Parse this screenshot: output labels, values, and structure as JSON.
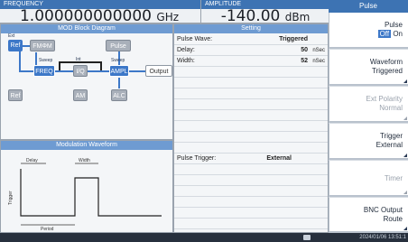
{
  "header": {
    "frequency_label": "FREQUENCY",
    "frequency_value": "1.000000000000",
    "frequency_unit": "GHz",
    "amplitude_label": "AMPLITUDE",
    "amplitude_value": "-140.00",
    "amplitude_unit": "dBm"
  },
  "diagram": {
    "title": "MOD Block Diagram",
    "blocks": {
      "ref1": "Ref",
      "fmphim": "FMΦM",
      "pulse": "Pulse",
      "freq": "FREQ",
      "iq": "I/Q",
      "ampl": "AMPL",
      "output": "Output",
      "ref2": "Ref",
      "am": "AM",
      "alc": "ALC"
    },
    "small_labels": {
      "sweep1": "Sweep",
      "sweep2": "Sweep",
      "int": "Int",
      "ext": "Ext"
    }
  },
  "waveform": {
    "title": "Modulation Waveform",
    "width_label": "Width",
    "delay_label": "Delay",
    "period_label": "Period",
    "trigger_label": "Trigger"
  },
  "setting": {
    "title": "Setting",
    "rows": [
      {
        "key": "Pulse Wave:",
        "value": "Triggered",
        "unit": ""
      },
      {
        "key": "Delay:",
        "value": "50",
        "unit": "nSec"
      },
      {
        "key": "Width:",
        "value": "52",
        "unit": "nSec"
      }
    ],
    "trigger_key": "Pulse Trigger:",
    "trigger_value": "External"
  },
  "softkeys": {
    "title": "Pulse",
    "pulse": {
      "l1": "Pulse",
      "l2a": "Off",
      "l2b": "On"
    },
    "waveform": {
      "l1": "Waveform",
      "l2": "Triggered"
    },
    "ext_polarity": {
      "l1": "Ext Polarity",
      "l2": "Normal"
    },
    "trigger": {
      "l1": "Trigger",
      "l2": "External"
    },
    "timer": {
      "l1": "Timer"
    },
    "bnc": {
      "l1": "BNC Output",
      "l2": "Route"
    }
  },
  "status": {
    "time": "2024/01/06 13:51:1"
  },
  "colors": {
    "accent_blue": "#3d78c8",
    "header_blue": "#3d73b3",
    "panel_title_blue": "#6e9bd2"
  }
}
